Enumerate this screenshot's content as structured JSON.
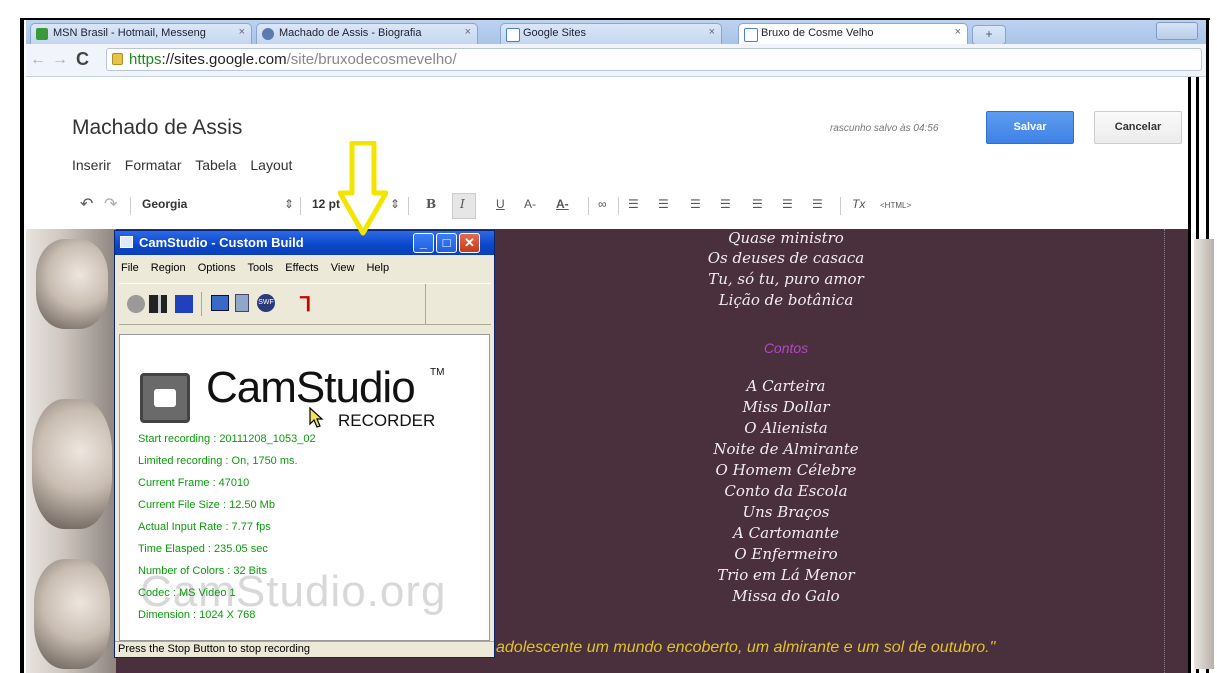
{
  "browser": {
    "tabs": [
      {
        "label": "MSN Brasil - Hotmail, Messeng",
        "icon": "msn-icon"
      },
      {
        "label": "Machado de Assis - Biografia",
        "icon": "globe-icon"
      },
      {
        "label": "Google Sites",
        "icon": "google-sites-icon"
      },
      {
        "label": "Bruxo de Cosme Velho",
        "icon": "google-sites-icon",
        "active": true
      }
    ],
    "url_https": "https",
    "url_host": "://sites.google.com",
    "url_path": "/site/bruxodecosmevelho/"
  },
  "sites": {
    "title": "Machado de Assis",
    "draft_status": "rascunho salvo às 04:56",
    "save_label": "Salvar",
    "cancel_label": "Cancelar",
    "menu": [
      "Inserir",
      "Formatar",
      "Tabela",
      "Layout"
    ],
    "toolbar": {
      "font": "Georgia",
      "size": "12 pt",
      "html_label": "<HTML>"
    }
  },
  "content": {
    "poems": [
      "Quase ministro",
      "Os deuses de casaca",
      "Tu, só tu, puro amor",
      "Lição de botânica"
    ],
    "contos_heading": "Contos",
    "contos": [
      "A Carteira",
      "Miss Dollar",
      "O Alienista",
      "Noite de Almirante",
      "O Homem Célebre",
      "Conto da Escola",
      "Uns Braços",
      "A Cartomante",
      "O Enfermeiro",
      "Trio em Lá Menor",
      "Missa do Galo"
    ],
    "quote": "adolescente um mundo encoberto, um almirante e um sol de outubro.\""
  },
  "camstudio": {
    "title": "CamStudio - Custom Build",
    "menu": [
      "File",
      "Region",
      "Options",
      "Tools",
      "Effects",
      "View",
      "Help"
    ],
    "logo_text": "CamStudio",
    "logo_tm": "TM",
    "logo_sub": "RECORDER",
    "watermark": "CamStudio.org",
    "stats": [
      "Start recording : 20111208_1053_02",
      "Limited recording : On, 1750 ms.",
      "Current Frame : 47010",
      "Current File Size : 12.50 Mb",
      "Actual Input Rate : 7.77 fps",
      "Time Elasped : 235.05 sec",
      "Number of Colors : 32 Bits",
      "Codec : MS Video 1",
      "Dimension : 1024 X 768"
    ],
    "status": "Press the Stop Button to stop recording",
    "stat_color": "#0a9a0a"
  }
}
